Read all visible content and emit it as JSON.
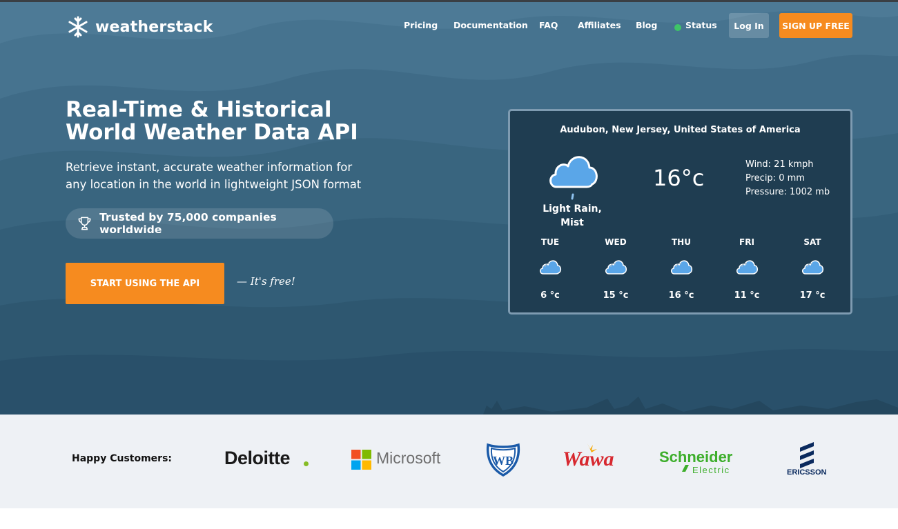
{
  "brand": {
    "name": "weatherstack",
    "logo_icon": "snowflake-icon"
  },
  "nav": {
    "links": [
      "Pricing",
      "Documentation",
      "FAQ",
      "Affiliates",
      "Blog",
      "Status"
    ],
    "login": "Log In",
    "signup": "SIGN UP FREE"
  },
  "hero": {
    "headline_line1": "Real-Time & Historical",
    "headline_line2": "World Weather Data API",
    "subline_line1": "Retrieve instant, accurate weather information for",
    "subline_line2": "any location in the world in lightweight JSON format",
    "trust": "Trusted by 75,000 companies worldwide",
    "cta": "START USING THE API",
    "cta_note": "— It's free!"
  },
  "widget": {
    "location": "Audubon, New Jersey, United States of America",
    "condition_line1": "Light Rain,",
    "condition_line2": "Mist",
    "temperature": "16°c",
    "wind": "Wind: 21 kmph",
    "precip": "Precip: 0 mm",
    "pressure": "Pressure: 1002 mb",
    "forecast": [
      {
        "day": "TUE",
        "temp": "6 °c"
      },
      {
        "day": "WED",
        "temp": "15 °c"
      },
      {
        "day": "THU",
        "temp": "16 °c"
      },
      {
        "day": "FRI",
        "temp": "11 °c"
      },
      {
        "day": "SAT",
        "temp": "17 °c"
      }
    ]
  },
  "customers": {
    "label": "Happy Customers:",
    "logos": [
      "Deloitte",
      "Microsoft",
      "Warner Bros",
      "Wawa",
      "Schneider Electric",
      "Ericsson"
    ],
    "deloitte": "Deloitte",
    "microsoft": "Microsoft",
    "wawa": "Wawa",
    "schneider_line1": "Schneider",
    "schneider_line2": "Electric",
    "ericsson": "ERICSSON"
  },
  "colors": {
    "accent": "#f68b1f",
    "hero_bg": "#3d6c8a",
    "widget_bg": "#1f3d51",
    "status_green": "#3ec567",
    "cloud_blue": "#5aa6e8"
  }
}
